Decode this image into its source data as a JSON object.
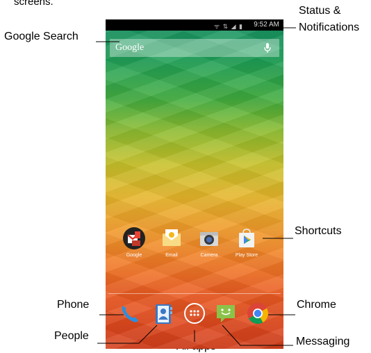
{
  "top_note": "screens.",
  "annotations": {
    "google_search": "Google Search",
    "status": "Status &\nNotifications",
    "status_line1": "Status &",
    "status_line2": "Notifications",
    "shortcuts": "Shortcuts",
    "phone": "Phone",
    "chrome": "Chrome",
    "people": "People",
    "all_apps": "All apps",
    "messaging": "Messaging"
  },
  "status_bar": {
    "time": "9:52 AM"
  },
  "search_bar": {
    "logo": "Google"
  },
  "apps": [
    {
      "label": "Google",
      "icon": "google-folder-icon"
    },
    {
      "label": "Email",
      "icon": "email-icon"
    },
    {
      "label": "Camera",
      "icon": "camera-icon"
    },
    {
      "label": "Play Store",
      "icon": "play-store-icon"
    }
  ],
  "dock": [
    "phone-icon",
    "people-icon",
    "all-apps-icon",
    "messaging-icon",
    "chrome-icon"
  ],
  "colors": {
    "leader_line": "#000000",
    "status_bar": "#000000"
  }
}
